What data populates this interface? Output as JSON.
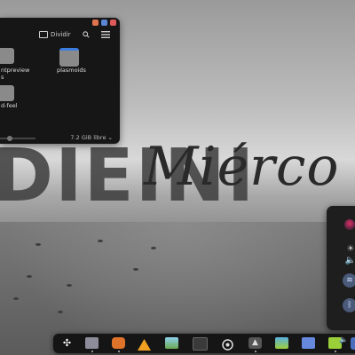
{
  "wallpaper": {
    "big_word": "DIE",
    "big_word_tail": "INI",
    "script_word": "Miérco"
  },
  "file_manager": {
    "split_label": "Dividir",
    "folders": [
      {
        "label": "ntpreview"
      },
      {
        "label": "plasmoids"
      },
      {
        "label": "d-feel"
      }
    ],
    "label_fragments": {
      "s": "s"
    },
    "free_space": "7.2 GiB libre",
    "colors": {
      "window_btn_1": "#e0734e",
      "window_btn_2": "#5b86d6",
      "window_btn_3": "#e05a5a",
      "folder": "#8a8a8a",
      "folder_blue": "#3b7de0"
    }
  },
  "control_panel": {
    "icons": [
      "avatar-icon",
      "brightness-icon",
      "volume-icon",
      "wifi-icon",
      "bluetooth-icon"
    ]
  },
  "dock": {
    "apps": [
      {
        "icon": "pinwheel-icon"
      },
      {
        "icon": "folder-icon"
      },
      {
        "icon": "fox-icon"
      },
      {
        "icon": "warning-app-icon"
      },
      {
        "icon": "image-viewer-icon"
      },
      {
        "icon": "terminal-icon"
      },
      {
        "icon": "settings-wheel-icon"
      },
      {
        "icon": "arrow-up-app-icon"
      },
      {
        "icon": "photos-icon"
      },
      {
        "icon": "display-icon"
      },
      {
        "icon": "note-icon"
      }
    ],
    "colors": {
      "folder": "#8c8c9a",
      "fox": "#e0732a",
      "warning": "#f0a020",
      "photos": "#5ab0e0",
      "display": "#6688dd",
      "note": "#9bcf3a"
    }
  }
}
